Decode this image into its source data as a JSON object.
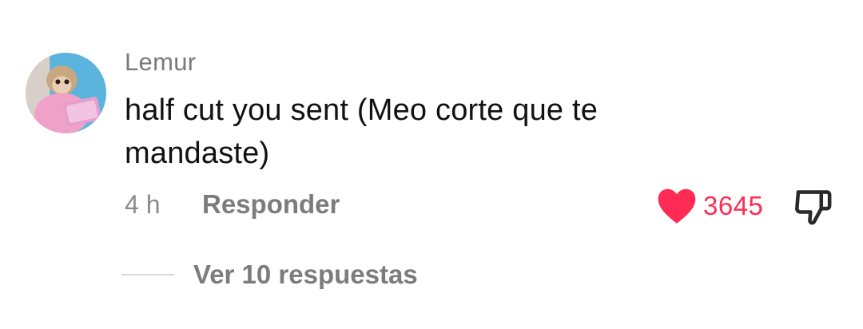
{
  "comment": {
    "username": "Lemur",
    "text": "half cut you sent (Meo corte que te mandaste)",
    "timestamp": "4 h",
    "reply_label": "Responder",
    "like_count": "3645",
    "liked": true,
    "view_replies_label": "Ver 10 respuestas"
  },
  "icons": {
    "like": "heart-icon",
    "dislike": "thumbs-down-icon",
    "avatar": "avatar"
  },
  "colors": {
    "accent": "#fe2c55",
    "username": "#7a7a7a",
    "text": "#111111",
    "secondary": "#7c7c7c"
  }
}
